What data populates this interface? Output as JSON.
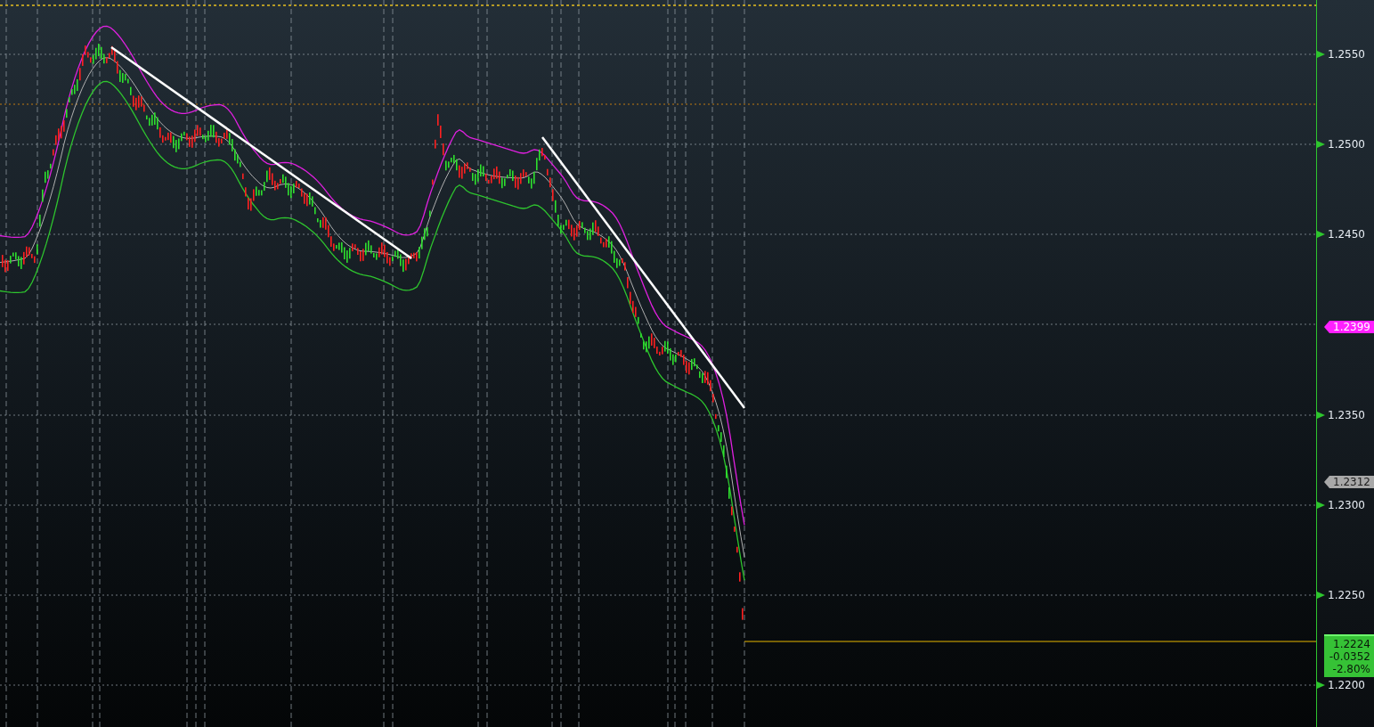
{
  "price_axis": {
    "ticks": [
      "1.2550",
      "1.2500",
      "1.2450",
      "1.2350",
      "1.2300",
      "1.2250",
      "1.2200"
    ],
    "badges": [
      {
        "kind": "upper-band",
        "value": "1.2399"
      },
      {
        "kind": "moving-average",
        "value": "1.2312"
      },
      {
        "kind": "last-price",
        "value": "1.2224",
        "change": "-0.0352",
        "percent": "-2.80%"
      }
    ]
  }
}
